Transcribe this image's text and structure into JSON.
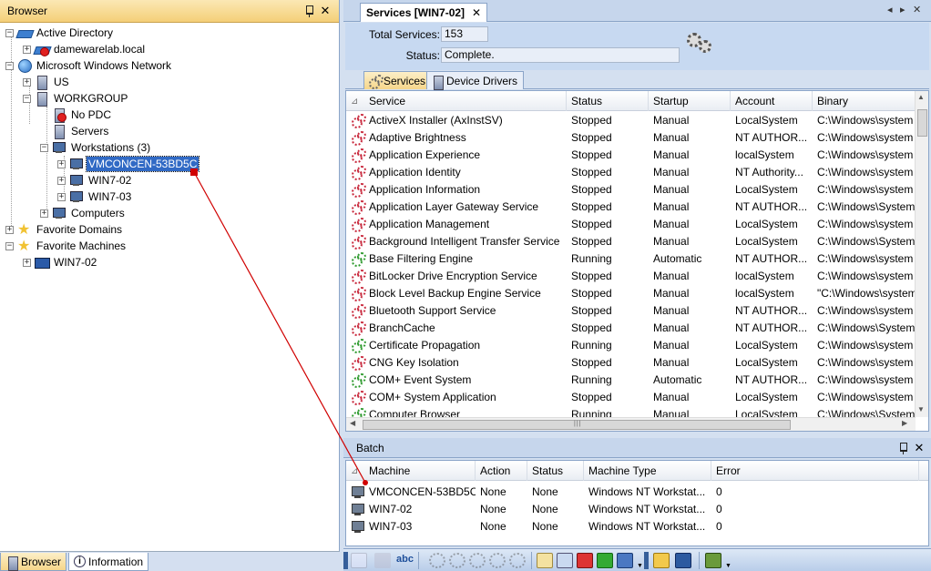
{
  "browser": {
    "title": "Browser",
    "tree": [
      {
        "label": "Active Directory",
        "icon": "active-directory-icon"
      },
      {
        "label": "damewarelab.local",
        "icon": "domain-error-icon"
      },
      {
        "label": "Microsoft Windows Network",
        "icon": "network-globe-icon"
      },
      {
        "label": "US",
        "icon": "workgroup-icon"
      },
      {
        "label": "WORKGROUP",
        "icon": "workgroup-icon"
      },
      {
        "label": "No PDC",
        "icon": "no-pdc-icon"
      },
      {
        "label": "Servers",
        "icon": "server-icon"
      },
      {
        "label": "Workstations (3)",
        "icon": "workstation-icon"
      },
      {
        "label": "VMCONCEN-53BD5C",
        "icon": "computer-icon"
      },
      {
        "label": "WIN7-02",
        "icon": "computer-icon"
      },
      {
        "label": "WIN7-03",
        "icon": "computer-icon"
      },
      {
        "label": "Computers",
        "icon": "computer-icon"
      },
      {
        "label": "Favorite Domains",
        "icon": "favorite-star-icon"
      },
      {
        "label": "Favorite Machines",
        "icon": "favorite-star-icon"
      },
      {
        "label": "WIN7-02",
        "icon": "computer-icon"
      }
    ],
    "bottom_tabs": [
      "Browser",
      "Information"
    ]
  },
  "document": {
    "tab_title": "Services [WIN7-02]",
    "close_glyph": "✕",
    "total_services_label": "Total Services:",
    "total_services_value": "153",
    "status_label": "Status:",
    "status_value": "Complete.",
    "subtabs": [
      "Services",
      "Device Drivers"
    ]
  },
  "services_table": {
    "columns": [
      "Service",
      "Status",
      "Startup",
      "Account",
      "Binary"
    ],
    "rows": [
      [
        "ActiveX Installer (AxInstSV)",
        "Stopped",
        "Manual",
        "LocalSystem",
        "C:\\Windows\\system"
      ],
      [
        "Adaptive Brightness",
        "Stopped",
        "Manual",
        "NT AUTHOR...",
        "C:\\Windows\\system"
      ],
      [
        "Application Experience",
        "Stopped",
        "Manual",
        "localSystem",
        "C:\\Windows\\system"
      ],
      [
        "Application Identity",
        "Stopped",
        "Manual",
        "NT Authority...",
        "C:\\Windows\\system"
      ],
      [
        "Application Information",
        "Stopped",
        "Manual",
        "LocalSystem",
        "C:\\Windows\\system"
      ],
      [
        "Application Layer Gateway Service",
        "Stopped",
        "Manual",
        "NT AUTHOR...",
        "C:\\Windows\\System"
      ],
      [
        "Application Management",
        "Stopped",
        "Manual",
        "LocalSystem",
        "C:\\Windows\\system"
      ],
      [
        "Background Intelligent Transfer Service",
        "Stopped",
        "Manual",
        "LocalSystem",
        "C:\\Windows\\System"
      ],
      [
        "Base Filtering Engine",
        "Running",
        "Automatic",
        "NT AUTHOR...",
        "C:\\Windows\\system"
      ],
      [
        "BitLocker Drive Encryption Service",
        "Stopped",
        "Manual",
        "localSystem",
        "C:\\Windows\\system"
      ],
      [
        "Block Level Backup Engine Service",
        "Stopped",
        "Manual",
        "localSystem",
        "\"C:\\Windows\\system"
      ],
      [
        "Bluetooth Support Service",
        "Stopped",
        "Manual",
        "NT AUTHOR...",
        "C:\\Windows\\system"
      ],
      [
        "BranchCache",
        "Stopped",
        "Manual",
        "NT AUTHOR...",
        "C:\\Windows\\System"
      ],
      [
        "Certificate Propagation",
        "Running",
        "Manual",
        "LocalSystem",
        "C:\\Windows\\system"
      ],
      [
        "CNG Key Isolation",
        "Stopped",
        "Manual",
        "LocalSystem",
        "C:\\Windows\\system"
      ],
      [
        "COM+ Event System",
        "Running",
        "Automatic",
        "NT AUTHOR...",
        "C:\\Windows\\system"
      ],
      [
        "COM+ System Application",
        "Stopped",
        "Manual",
        "LocalSystem",
        "C:\\Windows\\system"
      ],
      [
        "Computer Browser",
        "Running",
        "Manual",
        "LocalSystem",
        "C:\\Windows\\System"
      ]
    ]
  },
  "batch": {
    "title": "Batch",
    "columns": [
      "Machine",
      "Action",
      "Status",
      "Machine Type",
      "Error"
    ],
    "rows": [
      [
        "VMCONCEN-53BD5C",
        "None",
        "None",
        "Windows NT Workstat...",
        "0"
      ],
      [
        "WIN7-02",
        "None",
        "None",
        "Windows NT Workstat...",
        "0"
      ],
      [
        "WIN7-03",
        "None",
        "None",
        "Windows NT Workstat...",
        "0"
      ]
    ]
  },
  "toolbar": {
    "spell_label": "abc"
  },
  "colors": {
    "selection": "#316ac5",
    "running_icon": "#2e9a2e",
    "stopped_icon": "#c8283c",
    "connector_line": "#d00000"
  }
}
